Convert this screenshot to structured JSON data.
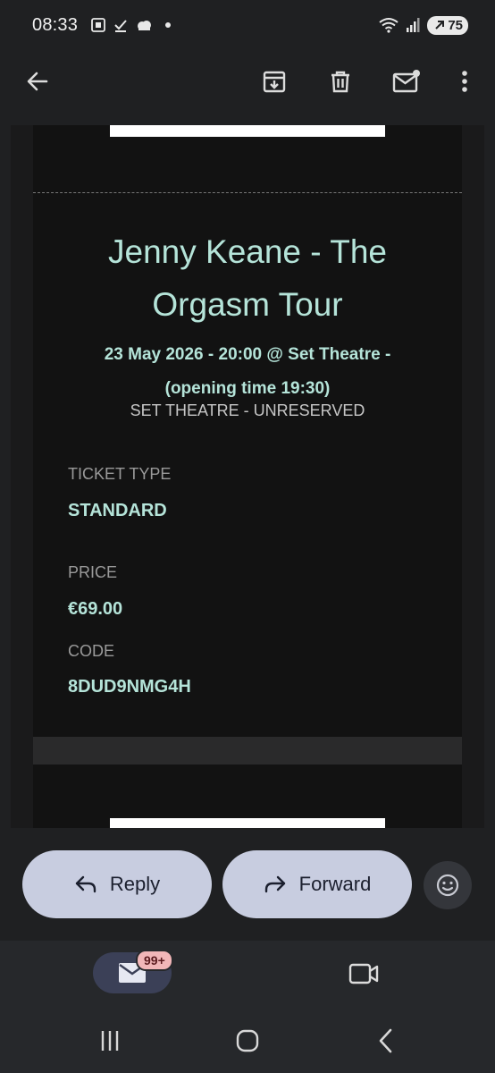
{
  "status_bar": {
    "time": "08:33",
    "battery": "75"
  },
  "toolbar": {
    "back_icon": "arrow-left-icon",
    "archive_icon": "archive-icon",
    "delete_icon": "trash-icon",
    "mark_unread_icon": "mail-unread-icon",
    "more_icon": "more-vert-icon"
  },
  "ticket": {
    "title_line1": "Jenny Keane - The",
    "title_line2": "Orgasm Tour",
    "when_line1": "23 May 2026 - 20:00 @ Set Theatre -",
    "when_line2": "(opening time 19:30)",
    "venue": "SET THEATRE - UNRESERVED",
    "fields": [
      {
        "label": "TICKET TYPE",
        "value": "STANDARD"
      },
      {
        "label": "PRICE",
        "value": "€69.00"
      },
      {
        "label": "CODE",
        "value": "8DUD9NMG4H"
      }
    ]
  },
  "actions": {
    "reply": "Reply",
    "forward": "Forward",
    "emoji_icon": "emoji-smile-icon"
  },
  "bottom_nav": {
    "mail_badge": "99+",
    "mail_icon": "mail-icon",
    "video_icon": "video-icon"
  },
  "system_nav": {
    "recents_icon": "recents-icon",
    "home_icon": "home-icon",
    "back_icon": "back-icon"
  },
  "colors": {
    "accent_text": "#b5e4d9",
    "pill_bg": "#c8cde0",
    "badge_bg": "#f1b6b8"
  }
}
